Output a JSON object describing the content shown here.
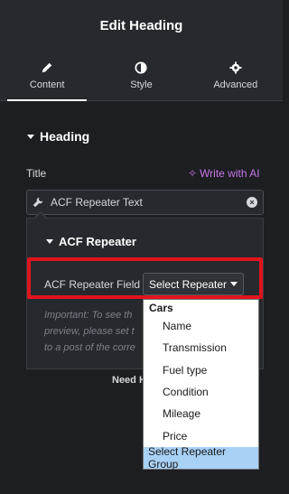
{
  "header": {
    "title": "Edit Heading"
  },
  "tabs": [
    {
      "label": "Content",
      "icon": "pencil-icon"
    },
    {
      "label": "Style",
      "icon": "contrast-icon"
    },
    {
      "label": "Advanced",
      "icon": "gear-icon"
    }
  ],
  "section": {
    "title": "Heading"
  },
  "title_field": {
    "label": "Title",
    "ai_link": "Write with AI",
    "value": "ACF Repeater Text"
  },
  "popover": {
    "heading": "ACF Repeater",
    "field_label": "ACF Repeater Field",
    "select_value": "Select Repeater",
    "note_lines": [
      "Important: To see th",
      "preview, please set t",
      "to a post of the corre"
    ]
  },
  "need_help": "Need H",
  "dropdown": {
    "group": "Cars",
    "options": [
      "Name",
      "Transmission",
      "Fuel type",
      "Condition",
      "Mileage",
      "Price"
    ],
    "selected": "Select Repeater Group"
  },
  "colors": {
    "accent_ai": "#c876e8",
    "highlight": "#e0141e",
    "selected_option": "#a8d1f6"
  }
}
